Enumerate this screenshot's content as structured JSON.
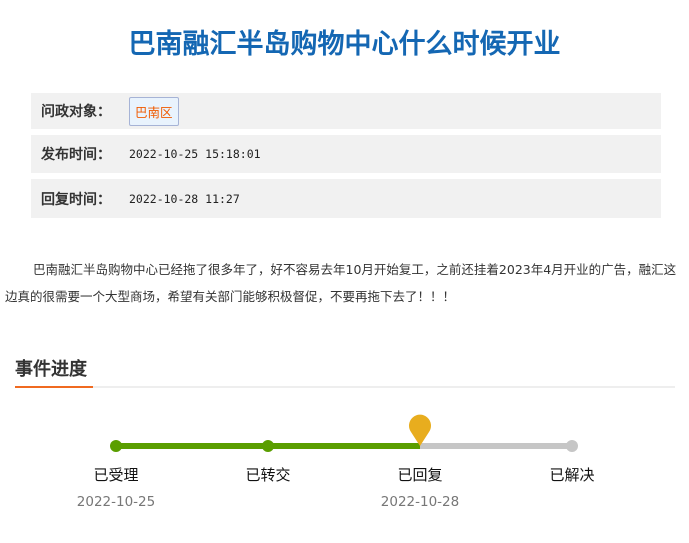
{
  "title": "巴南融汇半岛购物中心什么时候开业",
  "info": {
    "target_label": "问政对象：",
    "target_value": "巴南区",
    "publish_label": "发布时间：",
    "publish_value": "2022-10-25 15:18:01",
    "reply_label": "回复时间：",
    "reply_value": "2022-10-28 11:27"
  },
  "content": "巴南融汇半岛购物中心已经拖了很多年了，好不容易去年10月开始复工，之前还挂着2023年4月开业的广告，融汇这边真的很需要一个大型商场，希望有关部门能够积极督促，不要再拖下去了！！！",
  "progress": {
    "heading": "事件进度",
    "current_step": 3,
    "total_steps": 4,
    "steps": [
      {
        "label": "已受理",
        "date": "2022-10-25"
      },
      {
        "label": "已转交",
        "date": ""
      },
      {
        "label": "已回复",
        "date": "2022-10-28"
      },
      {
        "label": "已解决",
        "date": ""
      }
    ],
    "colors": {
      "done": "#5a9e00",
      "pending": "#c6c6c6",
      "marker": "#e8ad1e"
    }
  }
}
